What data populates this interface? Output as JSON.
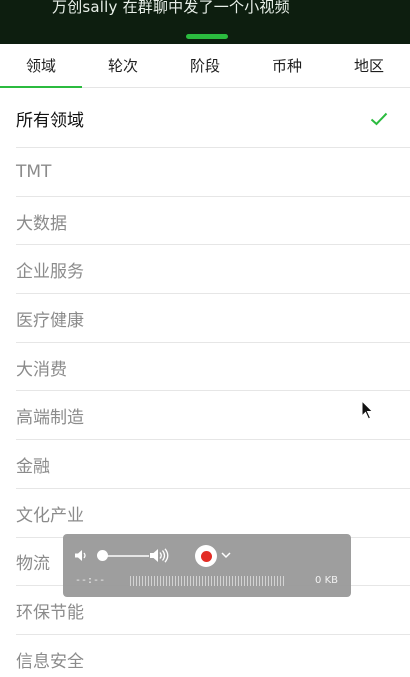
{
  "banner": {
    "text": "万创sally 在群聊中发了一个小视频",
    "accent": "#2bbb3f"
  },
  "tabs": [
    {
      "label": "领域",
      "active": true
    },
    {
      "label": "轮次",
      "active": false
    },
    {
      "label": "阶段",
      "active": false
    },
    {
      "label": "币种",
      "active": false
    },
    {
      "label": "地区",
      "active": false
    }
  ],
  "list": {
    "items": [
      {
        "label": "所有领域",
        "selected": true
      },
      {
        "label": "TMT"
      },
      {
        "label": "大数据"
      },
      {
        "label": "企业服务"
      },
      {
        "label": "医疗健康"
      },
      {
        "label": "大消费"
      },
      {
        "label": "高端制造"
      },
      {
        "label": "金融"
      },
      {
        "label": "文化产业"
      },
      {
        "label": "物流"
      },
      {
        "label": "环保节能"
      },
      {
        "label": "信息安全"
      }
    ]
  },
  "recorder": {
    "timer": "--:--",
    "size": "0 KB",
    "volume_level": 0.0,
    "record_color": "#e3261e"
  }
}
